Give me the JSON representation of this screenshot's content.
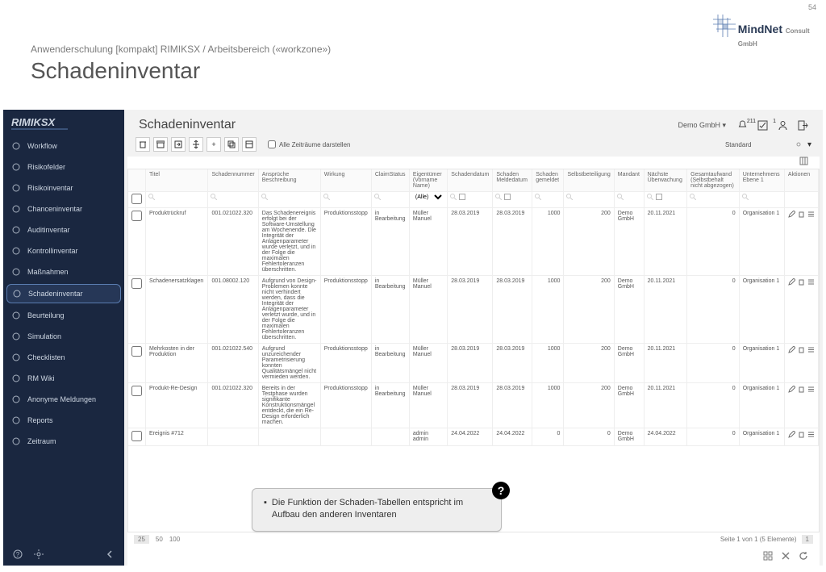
{
  "slide": {
    "number": "54",
    "breadcrumb": "Anwenderschulung [kompakt] RIMIKSX / Arbeitsbereich («workzone»)",
    "title": "Schadeninventar"
  },
  "brand_logo": "RIMIKSX",
  "sidebar": [
    {
      "label": "Workflow"
    },
    {
      "label": "Risikofelder"
    },
    {
      "label": "Risikoinventar"
    },
    {
      "label": "Chanceninventar"
    },
    {
      "label": "Auditinventar"
    },
    {
      "label": "Kontrollinventar"
    },
    {
      "label": "Maßnahmen"
    },
    {
      "label": "Schadeninventar",
      "active": true
    },
    {
      "label": "Beurteilung"
    },
    {
      "label": "Simulation"
    },
    {
      "label": "Checklisten"
    },
    {
      "label": "RM Wiki"
    },
    {
      "label": "Anonyme Meldungen"
    },
    {
      "label": "Reports"
    },
    {
      "label": "Zeitraum"
    }
  ],
  "page": {
    "title": "Schadeninventar",
    "tenant": "Demo GmbH ▾",
    "bell_count": "211",
    "check_count": "1"
  },
  "toolbar": {
    "checkbox_label": "Alle Zeiträume darstellen",
    "view": "Standard"
  },
  "columns": [
    "",
    "Titel",
    "Schadennummer",
    "Ansprüche Beschreibung",
    "Wirkung",
    "ClaimStatus",
    "Eigentümer (Vorname Name)",
    "Schadendatum",
    "Schaden Meldedatum",
    "Schaden gemeldet",
    "Selbstbeteiligung",
    "Mandant",
    "Nächste Überwachung",
    "Gesamtaufwand (Selbstbehalt nicht abgezogen)",
    "Unternehmens Ebene 1",
    "Aktionen"
  ],
  "filter_owner_all": "(Alle)",
  "rows": [
    {
      "titel": "Produktrückruf",
      "nr": "001.021022.320",
      "beschr": "Das Schadenereignis erfolgt bei der Software-Umstellung am Wochenende. Die Integrität der Anlagenparameter wurde verletzt, und in der Folge die maximalen Fehlertoleranzen überschritten.",
      "wirkung": "Produktionsstopp",
      "status": "in Bearbeitung",
      "owner": "Müller Manuel",
      "sdatum": "28.03.2019",
      "mdatum": "28.03.2019",
      "gemeldet": "1000",
      "selbst": "200",
      "mandant": "Demo GmbH",
      "ueberw": "20.11.2021",
      "aufwand": "0",
      "orga": "Organisation 1"
    },
    {
      "titel": "Schadenersatzklagen",
      "nr": "001.08002.120",
      "beschr": "Aufgrund von Design-Problemen konnte nicht verhindert werden, dass die Integrität der Anlagenparameter verletzt wurde, und in der Folge die maximalen Fehlertoleranzen überschritten.",
      "wirkung": "Produktionsstopp",
      "status": "in Bearbeitung",
      "owner": "Müller Manuel",
      "sdatum": "28.03.2019",
      "mdatum": "28.03.2019",
      "gemeldet": "1000",
      "selbst": "200",
      "mandant": "Demo GmbH",
      "ueberw": "20.11.2021",
      "aufwand": "0",
      "orga": "Organisation 1"
    },
    {
      "titel": "Mehrkosten in der Produktion",
      "nr": "001.021022.540",
      "beschr": "Aufgrund unzureichender Parametrisierung konnten Qualitätsmängel nicht vermieden werden.",
      "wirkung": "Produktionsstopp",
      "status": "in Bearbeitung",
      "owner": "Müller Manuel",
      "sdatum": "28.03.2019",
      "mdatum": "28.03.2019",
      "gemeldet": "1000",
      "selbst": "200",
      "mandant": "Demo GmbH",
      "ueberw": "20.11.2021",
      "aufwand": "0",
      "orga": "Organisation 1"
    },
    {
      "titel": "Produkt-Re-Design",
      "nr": "001.021022.320",
      "beschr": "Bereits in der Testphase wurden signifikante Konstruktionsmängel entdeckt, die ein Re-Design erforderlich machen.",
      "wirkung": "Produktionsstopp",
      "status": "in Bearbeitung",
      "owner": "Müller Manuel",
      "sdatum": "28.03.2019",
      "mdatum": "28.03.2019",
      "gemeldet": "1000",
      "selbst": "200",
      "mandant": "Demo GmbH",
      "ueberw": "20.11.2021",
      "aufwand": "0",
      "orga": "Organisation 1"
    },
    {
      "titel": "Ereignis #712",
      "nr": "",
      "beschr": "",
      "wirkung": "",
      "status": "",
      "owner": "admin admin",
      "sdatum": "24.04.2022",
      "mdatum": "24.04.2022",
      "gemeldet": "0",
      "selbst": "0",
      "mandant": "Demo GmbH",
      "ueberw": "24.04.2022",
      "aufwand": "0",
      "orga": "Organisation 1"
    }
  ],
  "paging": {
    "sizes": [
      "25",
      "50",
      "100"
    ],
    "active": "25",
    "info": "Seite 1 von 1 (5 Elemente)",
    "page": "1"
  },
  "callout": "Die Funktion der Schaden-Tabellen entspricht im Aufbau den anderen Inventaren"
}
